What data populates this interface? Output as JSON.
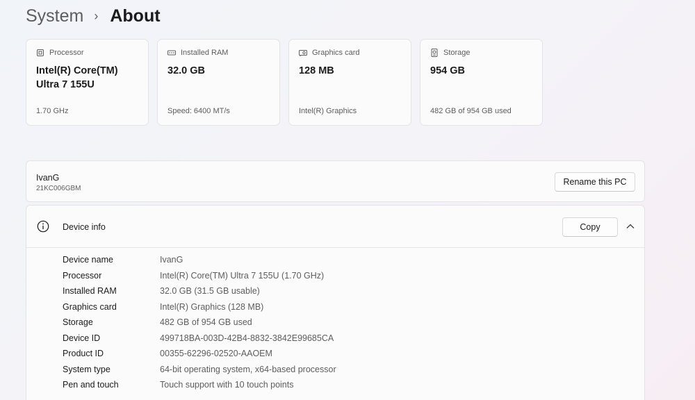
{
  "breadcrumb": {
    "parent": "System",
    "separator": "›",
    "current": "About"
  },
  "spec_cards": [
    {
      "icon": "processor-icon",
      "label": "Processor",
      "value": "Intel(R) Core(TM) Ultra 7 155U",
      "sub": "1.70 GHz"
    },
    {
      "icon": "ram-icon",
      "label": "Installed RAM",
      "value": "32.0 GB",
      "sub": "Speed: 6400 MT/s"
    },
    {
      "icon": "graphics-card-icon",
      "label": "Graphics card",
      "value": "128 MB",
      "sub": "Intel(R) Graphics"
    },
    {
      "icon": "storage-icon",
      "label": "Storage",
      "value": "954 GB",
      "sub": "482 GB of 954 GB used"
    }
  ],
  "pc": {
    "name": "IvanG",
    "model": "21KC006GBM",
    "rename_label": "Rename this PC"
  },
  "device_info": {
    "title": "Device info",
    "copy_label": "Copy",
    "expanded": true,
    "rows": [
      {
        "label": "Device name",
        "value": "IvanG"
      },
      {
        "label": "Processor",
        "value": "Intel(R) Core(TM) Ultra 7 155U (1.70 GHz)"
      },
      {
        "label": "Installed RAM",
        "value": "32.0 GB (31.5 GB usable)"
      },
      {
        "label": "Graphics card",
        "value": "Intel(R) Graphics (128 MB)"
      },
      {
        "label": "Storage",
        "value": "482 GB of 954 GB used"
      },
      {
        "label": "Device ID",
        "value": "499718BA-003D-42B4-8832-3842E99685CA"
      },
      {
        "label": "Product ID",
        "value": "00355-62296-02520-AAOEM"
      },
      {
        "label": "System type",
        "value": "64-bit operating system, x64-based processor"
      },
      {
        "label": "Pen and touch",
        "value": "Touch support with 10 touch points"
      }
    ]
  },
  "colors": {
    "text_primary": "#1b1b1b",
    "text_secondary": "#5d5d5d",
    "card_background": "#fbfbfc",
    "card_border": "#e3e3e6"
  }
}
